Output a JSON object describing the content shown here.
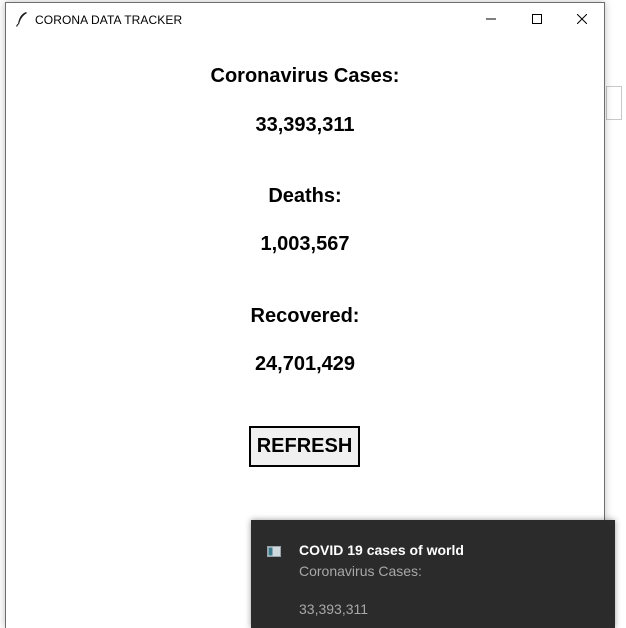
{
  "window": {
    "title": "CORONA DATA TRACKER",
    "controls": {
      "minimize_icon": "minimize-icon",
      "maximize_icon": "maximize-icon",
      "close_icon": "close-icon"
    },
    "app_icon": "feather-icon"
  },
  "stats": {
    "cases_label": "Coronavirus Cases:",
    "cases_value": "33,393,311",
    "deaths_label": "Deaths:",
    "deaths_value": "1,003,567",
    "recovered_label": "Recovered:",
    "recovered_value": "24,701,429"
  },
  "actions": {
    "refresh_label": "REFRESH"
  },
  "notification": {
    "icon": "app-window-icon",
    "title": "COVID 19 cases of world",
    "line1": "Coronavirus Cases:",
    "line2": "33,393,311"
  },
  "colors": {
    "toast_background": "#2b2b2b",
    "toast_secondary_text": "#a8a8a8",
    "button_background": "#f0f0f0"
  }
}
